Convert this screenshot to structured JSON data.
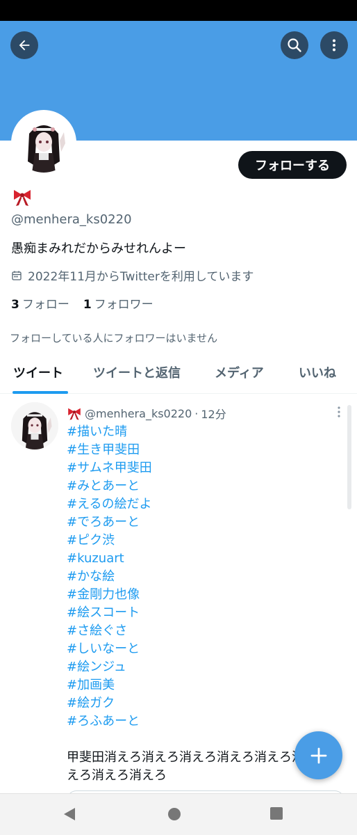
{
  "colors": {
    "banner": "#4a9de6",
    "accent": "#1d9bf0",
    "dark_button": "#0f1419",
    "fab": "#4a9de6"
  },
  "header": {
    "back_icon": "arrow-left-icon",
    "search_icon": "search-icon",
    "more_icon": "more-vertical-icon"
  },
  "profile": {
    "display_name_emoji": "🎀",
    "handle": "@menhera_ks0220",
    "bio": "愚痴まみれだからみせれんよー",
    "joined": "2022年11月からTwitterを利用しています",
    "following_count": "3",
    "following_label": "フォロー",
    "followers_count": "1",
    "followers_label": "フォロワー",
    "follow_button": "フォローする",
    "not_followed_note": "フォローしている人にフォロワーはいません"
  },
  "tabs": [
    {
      "label": "ツイート",
      "active": true
    },
    {
      "label": "ツイートと返信",
      "active": false
    },
    {
      "label": "メディア",
      "active": false
    },
    {
      "label": "いいね",
      "active": false
    }
  ],
  "tweet": {
    "name_emoji": "🎀",
    "handle": "@menhera_ks0220",
    "separator": "·",
    "time": "12分",
    "hashtags": [
      "#描いた晴",
      "#生き甲斐田",
      "#サムネ甲斐田",
      "#みとあーと",
      "#えるの絵だよ",
      "#でろあーと",
      "#ピク渋",
      "#kuzuart",
      "#かな絵",
      "#金剛力也像",
      "#絵スコート",
      "#さ絵ぐさ",
      "#しいなーと",
      "#絵ンジュ",
      "#加画美",
      "#絵ガク",
      "#ろふあーと"
    ],
    "body": "甲斐田消えろ消えろ消えろ消えろ消えろ消えろ消えろ消えろ消えろ"
  },
  "fab": {
    "icon": "plus-icon"
  },
  "system_nav": {
    "back": "nav-back-icon",
    "home": "nav-home-icon",
    "recents": "nav-recents-icon"
  }
}
